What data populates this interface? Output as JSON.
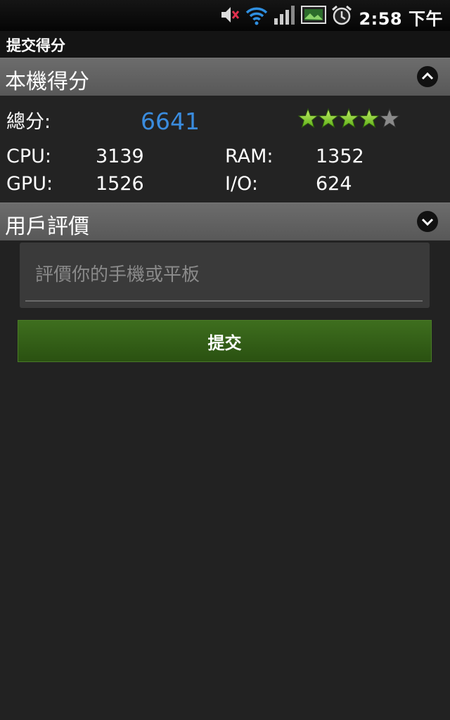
{
  "status_bar": {
    "time": "2:58 下午",
    "icons": [
      "mute-icon",
      "wifi-icon",
      "signal-icon",
      "image-notification-icon",
      "alarm-icon"
    ]
  },
  "title_bar": {
    "title": "提交得分"
  },
  "score_section": {
    "header": "本機得分",
    "total_label": "總分:",
    "total_value": "6641",
    "rating_stars": 4.5,
    "rating_max": 5,
    "star_color": "#7ed321",
    "rows": [
      {
        "left_label": "CPU:",
        "left_value": "3139",
        "right_label": "RAM:",
        "right_value": "1352"
      },
      {
        "left_label": "GPU:",
        "left_value": "1526",
        "right_label": "I/O:",
        "right_value": "624"
      }
    ]
  },
  "review_section": {
    "header": "用戶評價",
    "placeholder": "評價你的手機或平板",
    "submit_label": "提交"
  },
  "colors": {
    "accent_blue": "#3a8cde",
    "submit_green": "#3e6e1e",
    "background": "#222222"
  }
}
